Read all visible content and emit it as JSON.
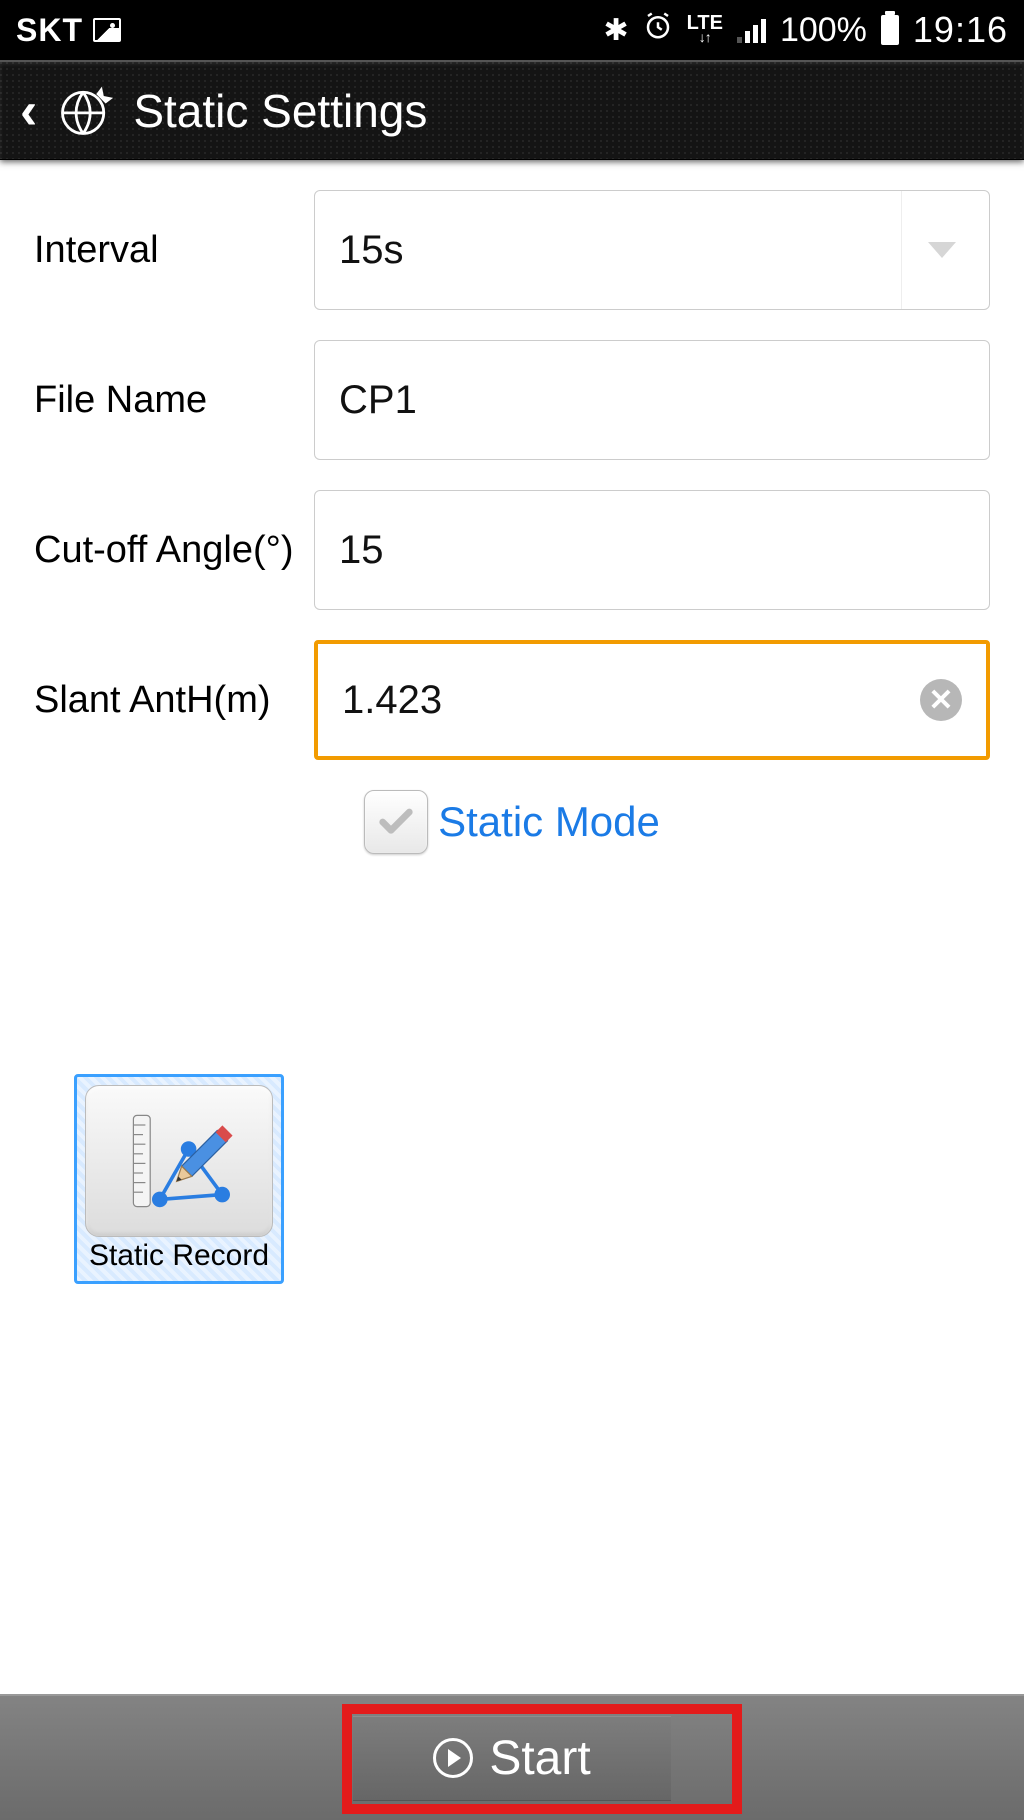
{
  "statusbar": {
    "carrier": "SKT",
    "battery_pct": "100%",
    "time": "19:16",
    "network": "LTE"
  },
  "titlebar": {
    "title": "Static Settings"
  },
  "form": {
    "interval": {
      "label": "Interval",
      "value": "15s"
    },
    "filename": {
      "label": "File Name",
      "value": "CP1"
    },
    "cutoff": {
      "label": "Cut-off Angle(°)",
      "value": "15"
    },
    "slant": {
      "label": "Slant AntH(m)",
      "value": "1.423"
    },
    "static_mode_label": "Static Mode"
  },
  "static_record": {
    "label": "Static Record"
  },
  "bottom": {
    "start_label": "Start"
  }
}
